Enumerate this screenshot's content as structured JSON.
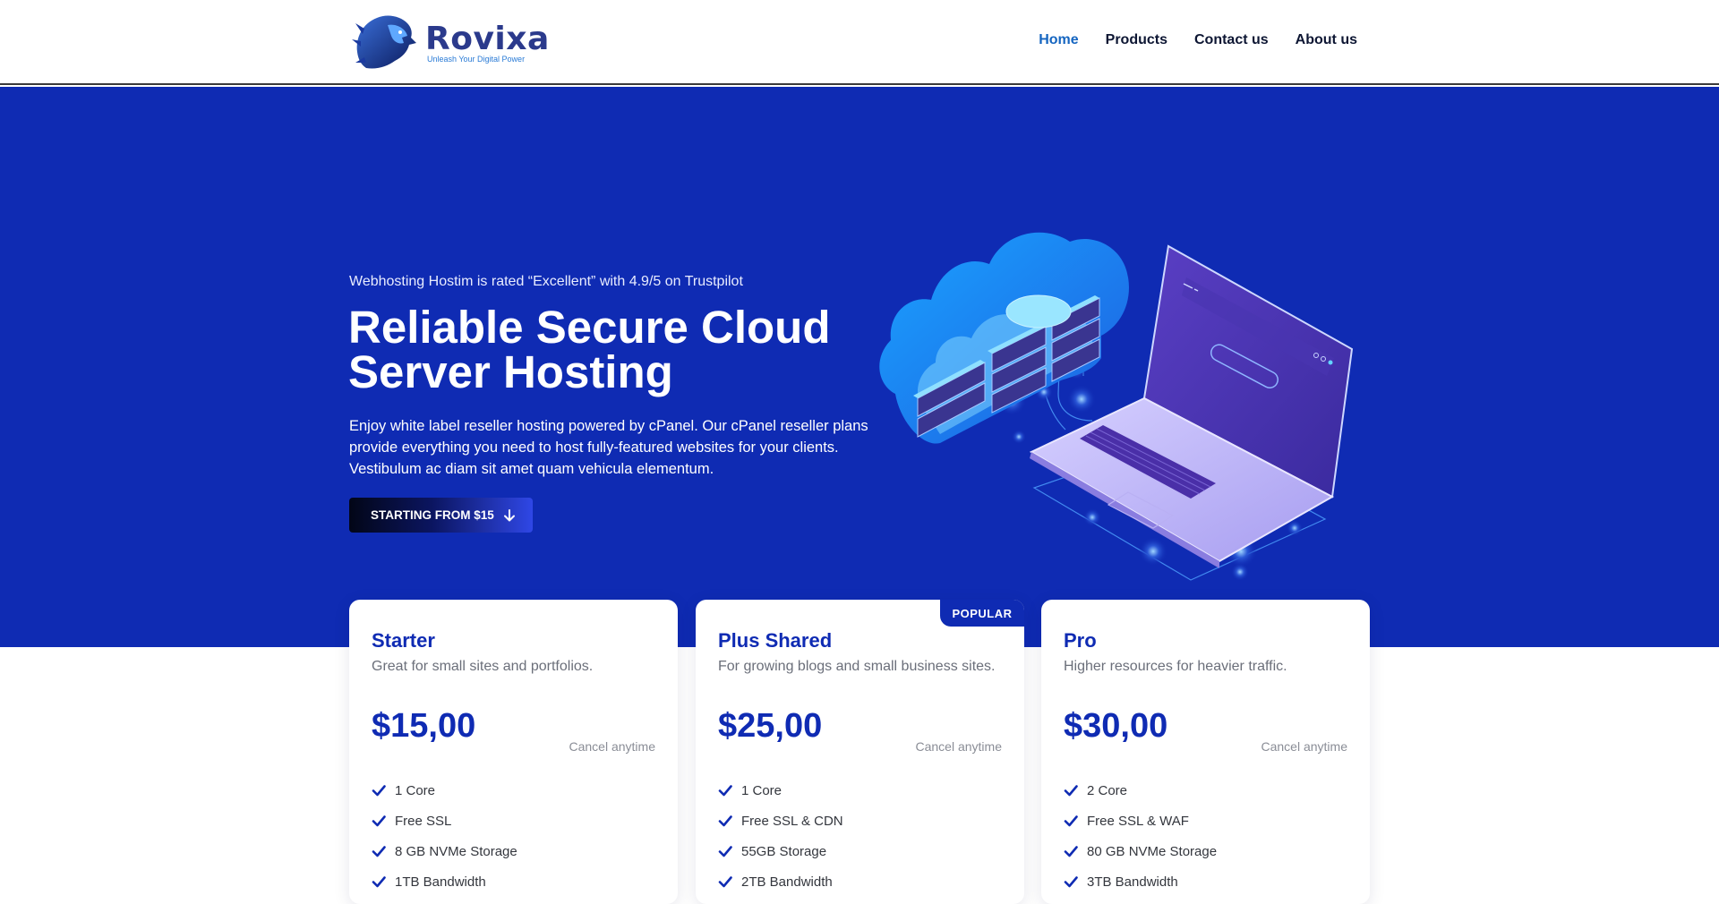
{
  "brand": {
    "name": "Rovixa",
    "tagline": "Unleash Your Digital Power"
  },
  "nav": {
    "items": [
      {
        "label": "Home",
        "active": true
      },
      {
        "label": "Products"
      },
      {
        "label": "Contact us"
      },
      {
        "label": "About us"
      }
    ]
  },
  "hero": {
    "rating": "Webhosting Hostim is rated “Excellent” with 4.9/5 on Trustpilot",
    "title": "Reliable Secure Cloud Server Hosting",
    "description": "Enjoy white label reseller hosting powered by cPanel. Our cPanel reseller plans provide everything you need to host fully-featured websites for your clients. Vestibulum ac diam sit amet quam vehicula elementum.",
    "cta_label": "STARTING FROM $15",
    "cta_icon": "arrow-down-icon"
  },
  "plans": [
    {
      "name": "Starter",
      "description": "Great for small sites and portfolios.",
      "price": "$15,00",
      "cancel": "Cancel anytime",
      "features": [
        "1 Core",
        "Free SSL",
        "8 GB NVMe Storage",
        "1TB Bandwidth"
      ]
    },
    {
      "name": "Plus Shared",
      "description": "For growing blogs and small business sites.",
      "price": "$25,00",
      "cancel": "Cancel anytime",
      "badge": "POPULAR",
      "features": [
        "1 Core",
        "Free SSL & CDN",
        "55GB Storage",
        "2TB Bandwidth"
      ]
    },
    {
      "name": "Pro",
      "description": "Higher resources for heavier traffic.",
      "price": "$30,00",
      "cancel": "Cancel anytime",
      "features": [
        "2 Core",
        "Free SSL & WAF",
        "80 GB NVMe Storage",
        "3TB Bandwidth"
      ]
    }
  ],
  "colors": {
    "primary": "#0f2bb3",
    "nav_active": "#1565c0",
    "text_dark": "#0d1633"
  }
}
